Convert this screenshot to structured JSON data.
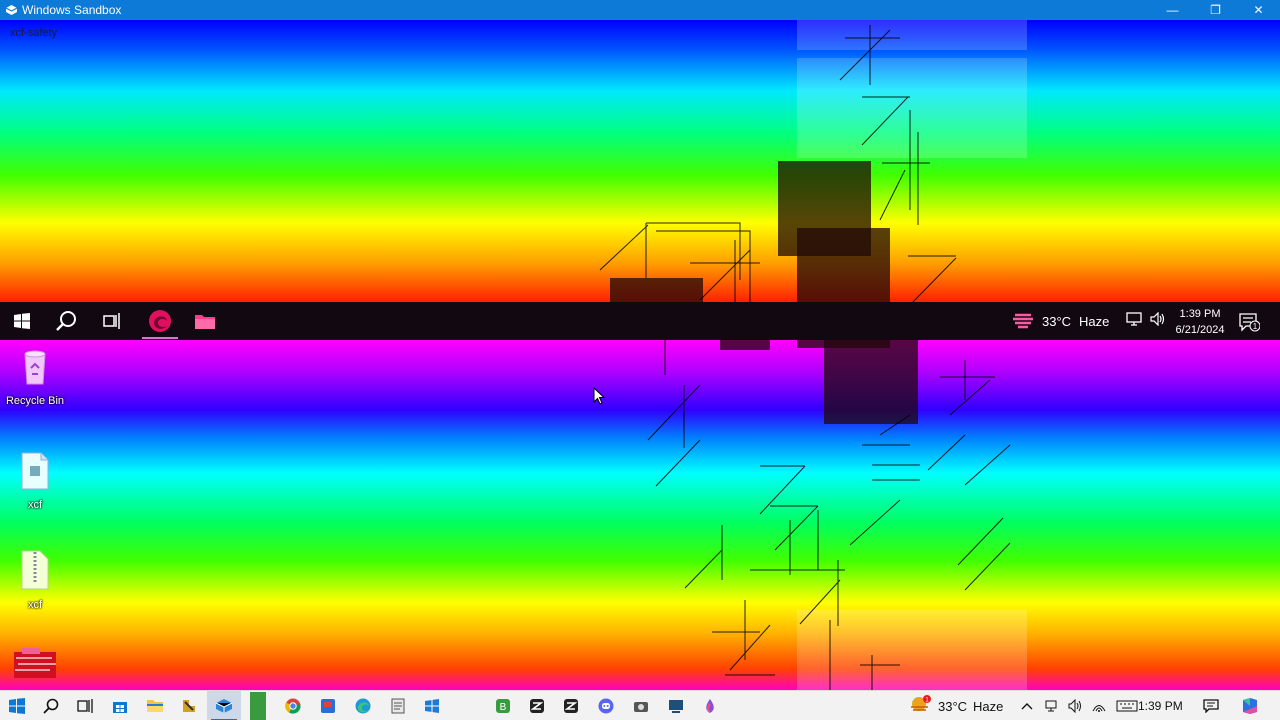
{
  "window": {
    "title": "Windows Sandbox",
    "minimize_glyph": "—",
    "restore_glyph": "❐",
    "close_glyph": "✕"
  },
  "sandbox_desktop": {
    "user_label": "xcf-safety",
    "inner_taskbar": {
      "weather_temp": "33°C",
      "weather_condition": "Haze",
      "time": "1:39 PM",
      "date": "6/21/2024",
      "notification_count": "1",
      "icons": [
        "windows-start-icon",
        "search-icon",
        "task-view-icon",
        "edge-icon",
        "file-explorer-icon"
      ]
    },
    "icons": [
      {
        "label": "Recycle Bin",
        "icon": "recycle-bin-icon"
      },
      {
        "label": "xcf",
        "icon": "file-icon"
      },
      {
        "label": "xcf",
        "icon": "zip-file-icon"
      },
      {
        "label": "",
        "icon": "glitched-icon"
      }
    ]
  },
  "host_taskbar": {
    "weather_temp": "33°C",
    "weather_condition": "Haze",
    "weather_badge": "1",
    "time": "1:39 PM",
    "apps": [
      "start",
      "search",
      "task-view",
      "store",
      "file-explorer",
      "toolbox",
      "sandbox",
      "terminal",
      "chrome",
      "app",
      "edge",
      "notepad",
      "windows-app",
      "b-app",
      "c-app",
      "d-app",
      "discord",
      "camera",
      "remote",
      "paint"
    ]
  },
  "colors": {
    "titlebar": "#0c7ad6",
    "inner_taskbar": "#120812",
    "host_taskbar": "#f2f2f2",
    "accent": "#0c78d4"
  }
}
